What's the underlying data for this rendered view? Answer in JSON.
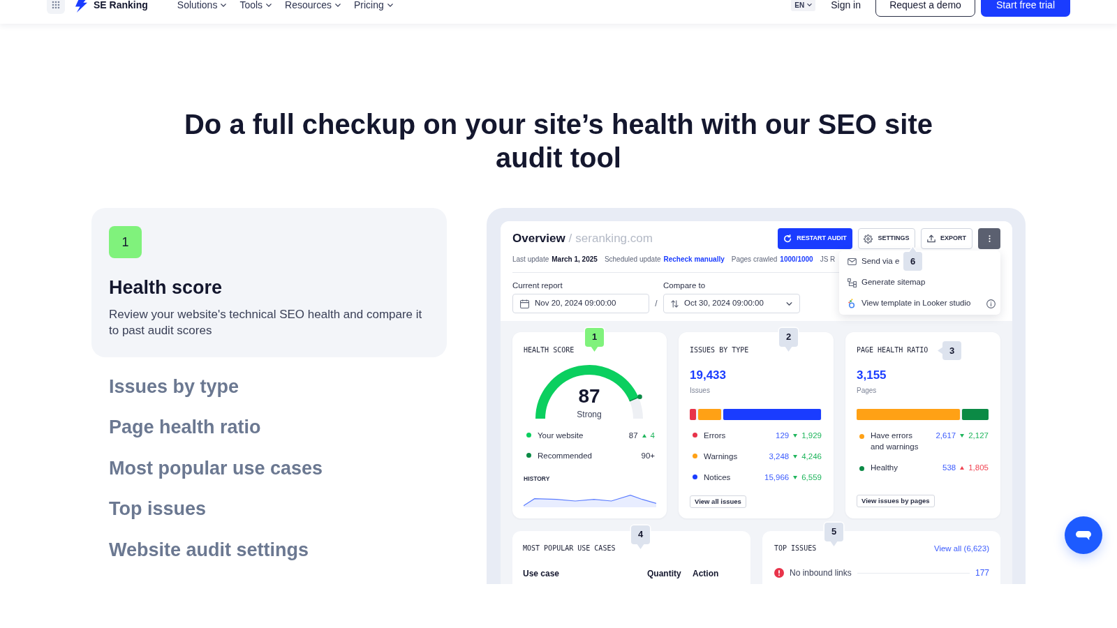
{
  "nav": {
    "logo": "SE Ranking",
    "menu": [
      {
        "label": "Solutions"
      },
      {
        "label": "Tools"
      },
      {
        "label": "Resources"
      },
      {
        "label": "Pricing"
      }
    ],
    "language": "EN",
    "sign_in": "Sign in",
    "buttons": [
      {
        "label": "Request a demo",
        "kind": "outline"
      },
      {
        "label": "Start free trial",
        "kind": "primary"
      }
    ]
  },
  "headline": "Do a full checkup on your site’s health with our SEO site audit tool",
  "features": [
    {
      "number": "1",
      "title": "Health score",
      "description": "Review your website's technical SEO health and compare it to past audit scores",
      "selected": true
    },
    {
      "title": "Issues by type",
      "selected": false
    },
    {
      "title": "Page health ratio",
      "selected": false
    },
    {
      "title": "Most popular use cases",
      "selected": false
    },
    {
      "title": "Top issues",
      "selected": false
    },
    {
      "title": "Website audit settings",
      "selected": false
    }
  ],
  "dashboard": {
    "title": "Overview",
    "separator": "/",
    "domain": "seranking.com",
    "actions": [
      {
        "label": "RESTART AUDIT",
        "kind": "restart"
      },
      {
        "label": "SETTINGS",
        "kind": "settings"
      },
      {
        "label": "EXPORT",
        "kind": "export"
      },
      {
        "kind": "more"
      }
    ],
    "info": [
      {
        "label": "Last update",
        "value": "March 1, 2025",
        "kind": "text"
      },
      {
        "label": "Scheduled update",
        "value": "Recheck manually",
        "kind": "link"
      },
      {
        "label": "Pages crawled",
        "value": "1000/1000",
        "kind": "link"
      },
      {
        "label": "JS R"
      }
    ],
    "menu": {
      "items": [
        {
          "label": "Send via e",
          "kind": "email",
          "info": false
        },
        {
          "label": "Generate sitemap",
          "kind": "sitemap",
          "info": false
        },
        {
          "label": "View template in Looker studio",
          "kind": "looker",
          "info": true
        }
      ],
      "callout": {
        "label": "6",
        "selected": false,
        "kind": "up"
      }
    },
    "current_report": {
      "label": "Current report",
      "value": "Nov 20, 2024 09:00:00"
    },
    "range_separator": "/",
    "compare_to": {
      "label": "Compare to",
      "value": "Oct 30, 2024 09:00:00"
    },
    "health_score": {
      "title": "HEALTH SCORE",
      "callout": {
        "label": "1",
        "selected": true,
        "kind": "down"
      },
      "gauge": {
        "level": 0.87,
        "score": "87",
        "rating": "Strong"
      },
      "legend": [
        {
          "label": "Your website",
          "value": "87",
          "rising": true,
          "change": "4",
          "positive": true,
          "color": "#0bcf5f"
        },
        {
          "label": "Recommended",
          "value": "90+",
          "color": "#0b8a45"
        }
      ],
      "history_label": "HISTORY"
    },
    "issues_by_type": {
      "title": "ISSUES BY TYPE",
      "callout": {
        "label": "2",
        "selected": false,
        "kind": "down"
      },
      "total": "19,433",
      "unit": "Issues",
      "items": [
        {
          "label": "Errors",
          "value": "129",
          "rising": false,
          "change": "1,929",
          "positive": true,
          "color": "#e8334a",
          "level": 0.05
        },
        {
          "label": "Warnings",
          "value": "3,248",
          "rising": false,
          "change": "4,246",
          "positive": true,
          "color": "#ffa115",
          "level": 0.17
        },
        {
          "label": "Notices",
          "value": "15,966",
          "rising": false,
          "change": "6,559",
          "positive": true,
          "color": "#1a3cff",
          "level": 0.745
        }
      ],
      "button": "View all issues"
    },
    "page_health_ratio": {
      "title": "PAGE HEALTH RATIO",
      "callout": {
        "label": "3",
        "selected": false,
        "kind": "left"
      },
      "total": "3,155",
      "unit": "Pages",
      "items": [
        {
          "label": "Have errors and warnings",
          "value": "2,617",
          "rising": false,
          "change": "2,127",
          "positive": true,
          "color": "#ffa115",
          "level": 0.785
        },
        {
          "label": "Healthy",
          "value": "538",
          "rising": true,
          "change": "1,805",
          "positive": false,
          "color": "#0b8a45",
          "level": 0.2
        }
      ],
      "button": "View issues by pages"
    },
    "use_cases": {
      "title": "MOST POPULAR USE CASES",
      "callout": {
        "label": "4",
        "selected": false,
        "kind": "down"
      },
      "columns": [
        "Use case",
        "Quantity",
        "Action"
      ]
    },
    "top_issues": {
      "title": "TOP ISSUES",
      "callout": {
        "label": "5",
        "selected": false,
        "kind": "down"
      },
      "link": "View all (6,623)",
      "rows": [
        {
          "label": "No inbound links",
          "count": "177",
          "kind": "error"
        }
      ]
    }
  }
}
